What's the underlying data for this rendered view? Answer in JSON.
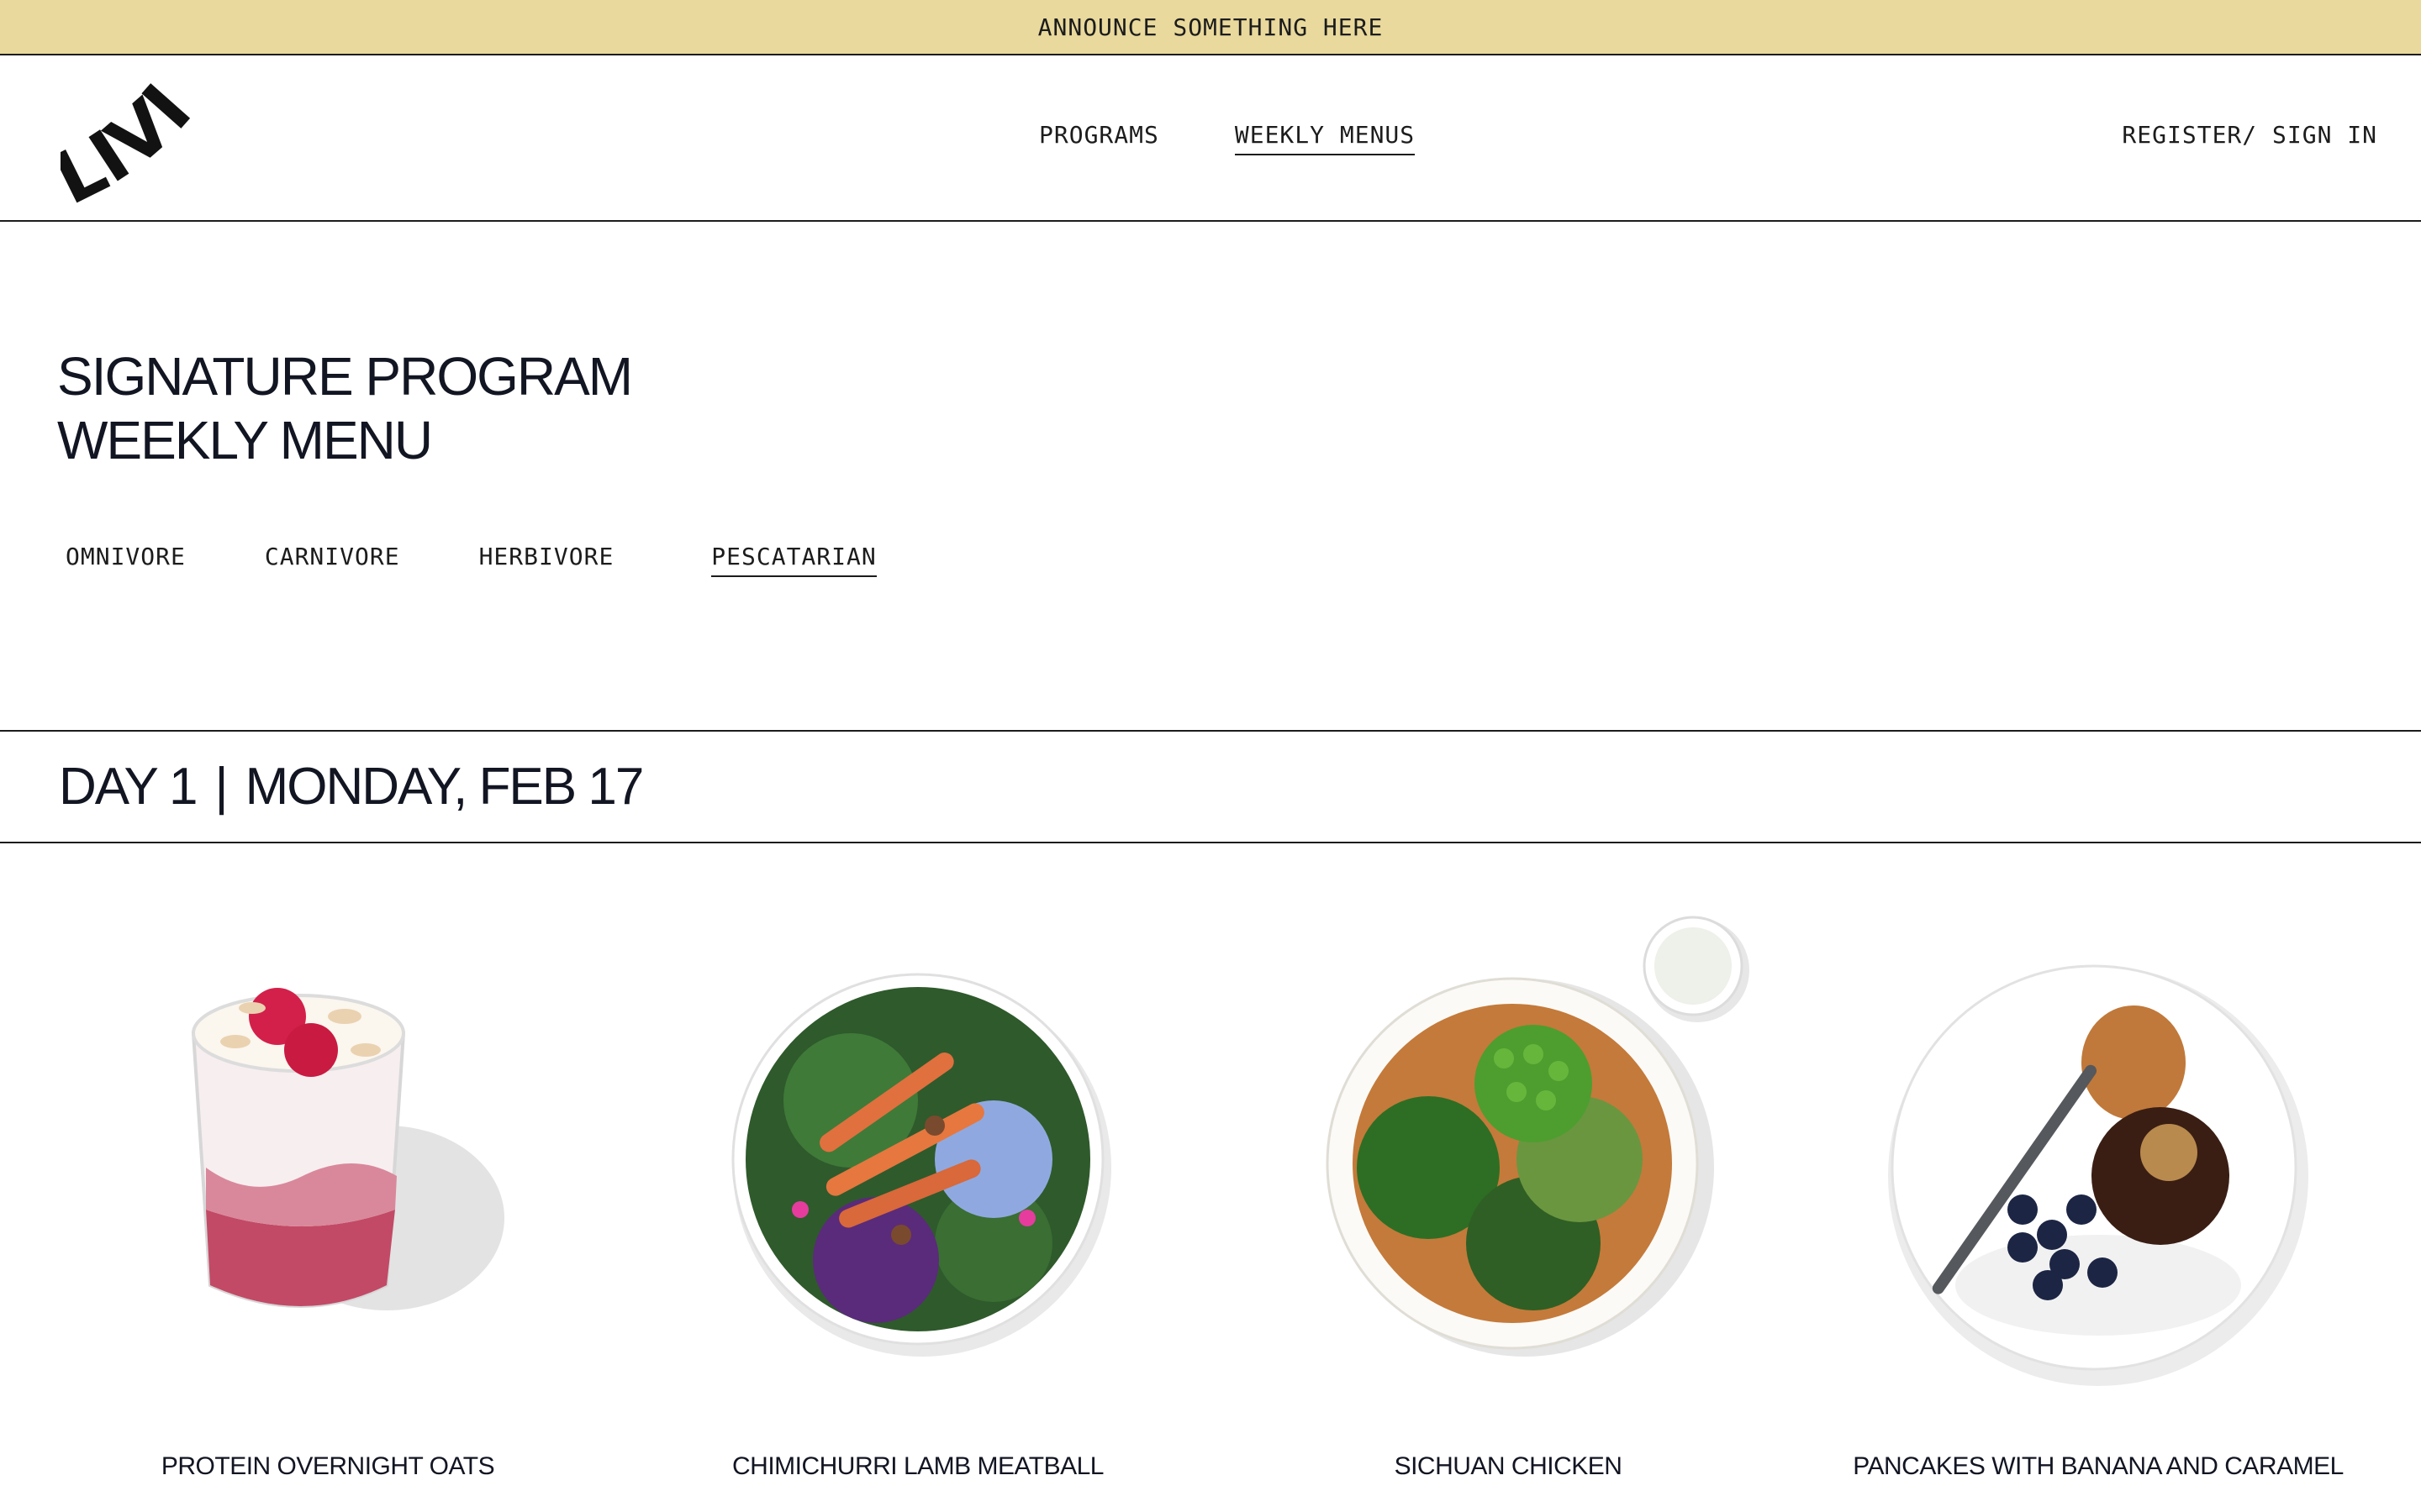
{
  "announcement": "ANNOUNCE SOMETHING HERE",
  "brand": {
    "logo_text": "LIVIT"
  },
  "nav": {
    "items": [
      {
        "label": "PROGRAMS",
        "active": false
      },
      {
        "label": "WEEKLY MENUS",
        "active": true
      }
    ],
    "auth_label": "REGISTER/ SIGN IN"
  },
  "hero": {
    "title_line1": "SIGNATURE PROGRAM",
    "title_line2": "WEEKLY MENU"
  },
  "diet_tabs": [
    {
      "label": "OMNIVORE",
      "active": false
    },
    {
      "label": "CARNIVORE",
      "active": false
    },
    {
      "label": "HERBIVORE",
      "active": false
    },
    {
      "label": "PESCATARIAN",
      "active": true
    }
  ],
  "day": {
    "day_label": "DAY 1",
    "separator": "|",
    "date_label": "MONDAY, FEB 17"
  },
  "meals": [
    {
      "name": "PROTEIN OVERNIGHT OATS",
      "image_icon": "overnight-oats-image"
    },
    {
      "name": "CHIMICHURRI LAMB MEATBALL",
      "image_icon": "lamb-salad-image"
    },
    {
      "name": "SICHUAN CHICKEN",
      "image_icon": "sichuan-bowl-image"
    },
    {
      "name": "PANCAKES WITH BANANA AND CARAMEL",
      "image_icon": "pancake-plate-image"
    }
  ],
  "colors": {
    "announce_bg": "#e9d99c",
    "text": "#14161c",
    "rule": "#1c1c1c"
  }
}
